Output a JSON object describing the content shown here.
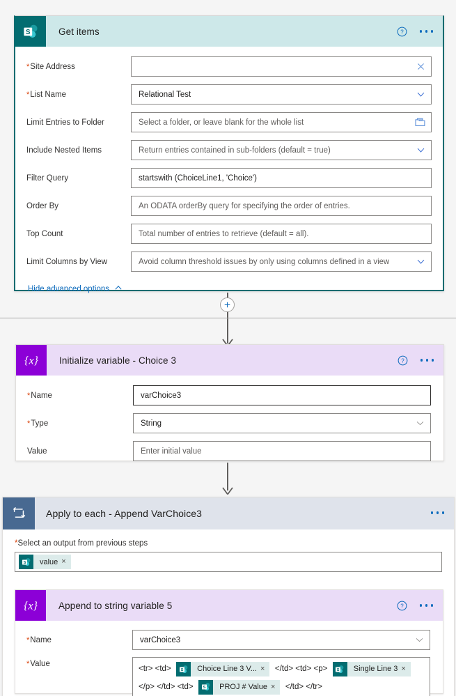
{
  "theme": {
    "sharepoint_teal": "#036C70",
    "variable_purple": "#8C00D7",
    "loop_blue": "#486991",
    "accent_blue": "#0F6CBD",
    "required_red": "#D83B01",
    "canvas_bg": "#F5F5F5"
  },
  "get_items": {
    "title": "Get items",
    "icon": "sharepoint-icon",
    "help_icon": "help-circle-icon",
    "menu_icon": "ellipsis-icon",
    "fields": [
      {
        "label": "Site Address",
        "required": true,
        "value": "",
        "placeholder": "",
        "control": "clear",
        "trailing_icon": "close-icon"
      },
      {
        "label": "List Name",
        "required": true,
        "value": "Relational Test",
        "placeholder": "",
        "control": "dropdown",
        "trailing_icon": "chevron-down-icon"
      },
      {
        "label": "Limit Entries to Folder",
        "required": false,
        "value": "",
        "placeholder": "Select a folder, or leave blank for the whole list",
        "control": "picker",
        "trailing_icon": "folder-icon"
      },
      {
        "label": "Include Nested Items",
        "required": false,
        "value": "",
        "placeholder": "Return entries contained in sub-folders (default = true)",
        "control": "dropdown",
        "trailing_icon": "chevron-down-icon"
      },
      {
        "label": "Filter Query",
        "required": false,
        "value": "startswith (ChoiceLine1, 'Choice')",
        "placeholder": "",
        "control": "text",
        "trailing_icon": ""
      },
      {
        "label": "Order By",
        "required": false,
        "value": "",
        "placeholder": "An ODATA orderBy query for specifying the order of entries.",
        "control": "text",
        "trailing_icon": ""
      },
      {
        "label": "Top Count",
        "required": false,
        "value": "",
        "placeholder": "Total number of entries to retrieve (default = all).",
        "control": "text",
        "trailing_icon": ""
      },
      {
        "label": "Limit Columns by View",
        "required": false,
        "value": "",
        "placeholder": "Avoid column threshold issues by only using columns defined in a view",
        "control": "dropdown",
        "trailing_icon": "chevron-down-icon"
      }
    ],
    "advanced_link": {
      "label": "Hide advanced options",
      "icon": "chevron-up-icon"
    }
  },
  "add_step": {
    "icon": "plus-icon",
    "label": "+"
  },
  "initialize_variable": {
    "title": "Initialize variable - Choice 3",
    "icon": "variable-icon",
    "help_icon": "help-circle-icon",
    "menu_icon": "ellipsis-icon",
    "fields": [
      {
        "label": "Name",
        "required": true,
        "value": "varChoice3",
        "placeholder": "",
        "control": "text",
        "trailing_icon": ""
      },
      {
        "label": "Type",
        "required": true,
        "value": "String",
        "placeholder": "",
        "control": "dropdown",
        "trailing_icon": "chevron-down-icon"
      },
      {
        "label": "Value",
        "required": false,
        "value": "",
        "placeholder": "Enter initial value",
        "control": "text",
        "trailing_icon": ""
      }
    ]
  },
  "apply_to_each": {
    "title": "Apply to each - Append VarChoice3",
    "icon": "loop-icon",
    "menu_icon": "ellipsis-icon",
    "select_output": {
      "label": "Select an output from previous steps",
      "required": true,
      "token": {
        "label": "value",
        "icon": "sharepoint-icon",
        "remove": "×"
      }
    },
    "append_to_string": {
      "title": "Append to string variable 5",
      "icon": "variable-icon",
      "help_icon": "help-circle-icon",
      "menu_icon": "ellipsis-icon",
      "name_field": {
        "label": "Name",
        "required": true,
        "value": "varChoice3",
        "control": "dropdown",
        "trailing_icon": "chevron-down-icon"
      },
      "value_field": {
        "label": "Value",
        "required": true,
        "parts": [
          {
            "kind": "text",
            "text": "<tr> <td>"
          },
          {
            "kind": "token",
            "label": "Choice Line 3 V...",
            "icon": "sharepoint-icon",
            "remove": "×"
          },
          {
            "kind": "text",
            "text": "</td> <td> <p>"
          },
          {
            "kind": "token",
            "label": "Single Line 3",
            "icon": "sharepoint-icon",
            "remove": "×"
          },
          {
            "kind": "break"
          },
          {
            "kind": "text",
            "text": "</p> </td> <td>"
          },
          {
            "kind": "token",
            "label": "PROJ # Value",
            "icon": "sharepoint-icon",
            "remove": "×"
          },
          {
            "kind": "text",
            "text": "</td> </tr>"
          }
        ]
      }
    }
  }
}
